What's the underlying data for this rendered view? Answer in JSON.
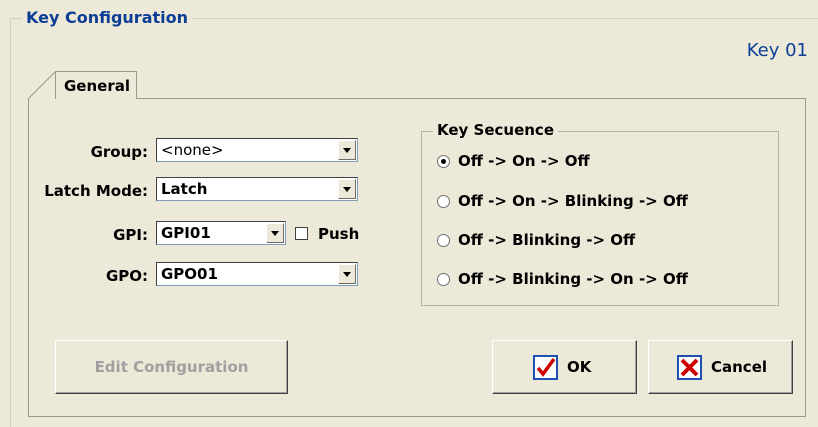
{
  "window": {
    "title": "Key Configuration",
    "key_id": "Key 01"
  },
  "tabs": [
    {
      "label": "General",
      "active": true
    }
  ],
  "form": {
    "group": {
      "label": "Group:",
      "value": "<none>"
    },
    "latch_mode": {
      "label": "Latch Mode:",
      "value": "Latch"
    },
    "gpi": {
      "label": "GPI:",
      "value": "GPI01",
      "push_label": "Push",
      "push_checked": false
    },
    "gpo": {
      "label": "GPO:",
      "value": "GPO01"
    }
  },
  "key_sequence": {
    "title": "Key Secuence",
    "options": [
      {
        "label": "Off -> On -> Off",
        "selected": true
      },
      {
        "label": "Off -> On -> Blinking -> Off",
        "selected": false
      },
      {
        "label": "Off -> Blinking -> Off",
        "selected": false
      },
      {
        "label": "Off -> Blinking -> On -> Off",
        "selected": false
      }
    ]
  },
  "buttons": {
    "edit_config": "Edit Configuration",
    "ok": "OK",
    "cancel": "Cancel"
  },
  "colors": {
    "background": "#ece9d8",
    "title_blue": "#0b3e94",
    "ok_check": "#cc0000",
    "icon_border": "#1f4fb0",
    "cancel_x": "#cc0000"
  },
  "icons": {
    "ok": "checkmark-icon",
    "cancel": "x-icon"
  }
}
